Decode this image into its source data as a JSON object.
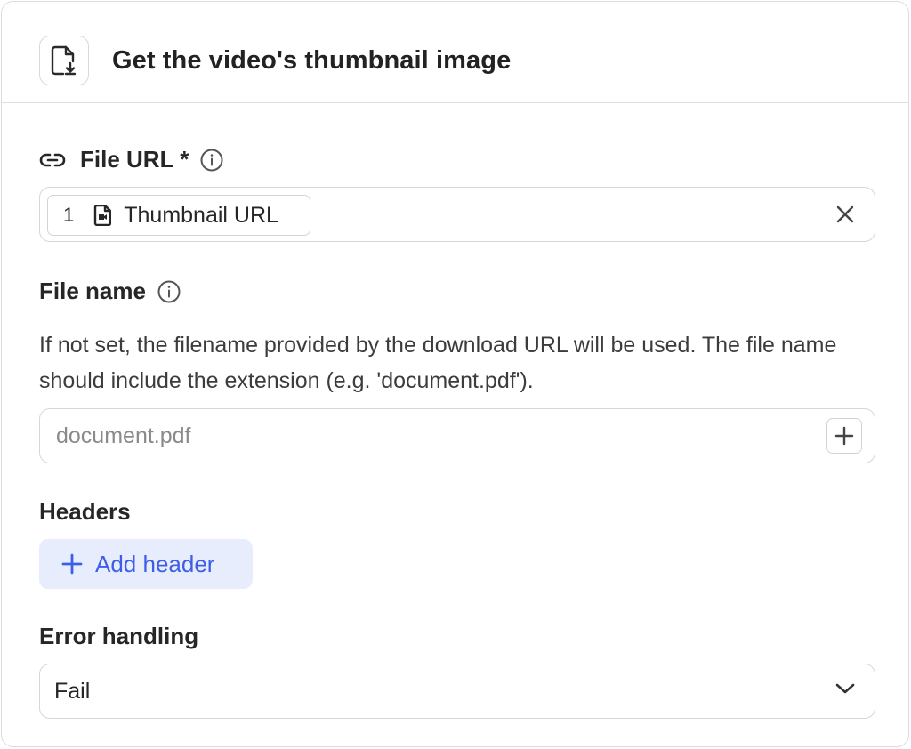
{
  "header": {
    "title": "Get the video's thumbnail image",
    "icon": "file-download-icon"
  },
  "file_url": {
    "label": "File URL *",
    "icon": "link-icon",
    "info_icon": "info-icon",
    "chip": {
      "number": "1",
      "icon": "file-video-icon",
      "text": "Thumbnail URL"
    },
    "clear_icon": "close-icon"
  },
  "file_name": {
    "label": "File name",
    "info_icon": "info-icon",
    "help": "If not set, the filename provided by the download URL will be used. The file name should include the extension (e.g. 'document.pdf').",
    "placeholder": "document.pdf",
    "value": "",
    "add_icon": "plus-icon"
  },
  "headers": {
    "label": "Headers",
    "add_button_label": "Add header",
    "add_icon": "plus-icon"
  },
  "error_handling": {
    "label": "Error handling",
    "selected": "Fail",
    "chevron_icon": "chevron-down-icon"
  },
  "colors": {
    "accent": "#3f5ee8",
    "accent_bg": "#e8edfd",
    "border": "#d7d7d7",
    "text": "#262626",
    "placeholder": "#8a8a8a"
  }
}
